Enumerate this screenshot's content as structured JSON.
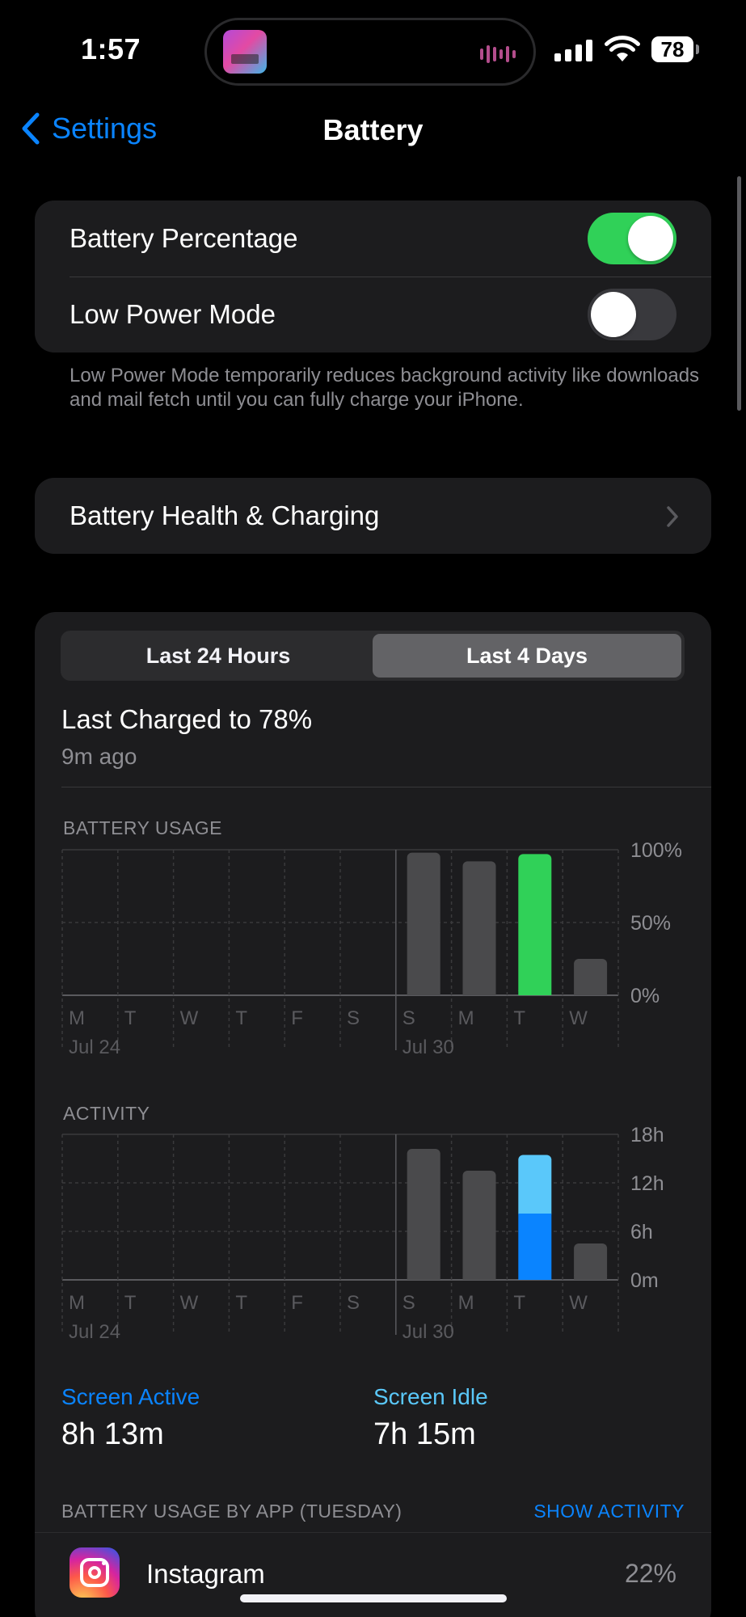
{
  "status_bar": {
    "time": "1:57",
    "battery_level": "78",
    "signal_bars": 4,
    "icons": [
      "now-playing-art",
      "audio-waveform-icon",
      "cellular-signal-icon",
      "wifi-icon",
      "battery-icon"
    ]
  },
  "nav": {
    "back_label": "Settings",
    "title": "Battery",
    "back_icon": "chevron-left-icon"
  },
  "settings": {
    "battery_percentage": {
      "label": "Battery Percentage",
      "on": true
    },
    "low_power_mode": {
      "label": "Low Power Mode",
      "on": false
    },
    "low_power_footnote": "Low Power Mode temporarily reduces background activity like downloads and mail fetch until you can fully charge your iPhone.",
    "battery_health_label": "Battery Health & Charging"
  },
  "usage": {
    "segments": [
      "Last 24 Hours",
      "Last 4 Days"
    ],
    "selected_segment": "Last 4 Days",
    "last_charged": "Last Charged to 78%",
    "last_charged_ago": "9m ago",
    "screen_active_label": "Screen Active",
    "screen_active_value": "8h 13m",
    "screen_idle_label": "Screen Idle",
    "screen_idle_value": "7h 15m",
    "by_app_heading": "BATTERY USAGE BY APP (TUESDAY)",
    "show_activity": "SHOW ACTIVITY",
    "apps": [
      {
        "name": "Instagram",
        "percent": "22%",
        "icon": "instagram-icon"
      }
    ]
  },
  "colors": {
    "accent": "#0a84ff",
    "toggle_on": "#30d158",
    "selected_bar": "#30d158",
    "idle": "#5ac8fa",
    "active": "#0a84ff",
    "bar": "#4a4a4c"
  },
  "chart_data": [
    {
      "type": "bar",
      "title": "BATTERY USAGE",
      "categories": [
        "M",
        "T",
        "W",
        "T",
        "F",
        "S",
        "S",
        "M",
        "T",
        "W"
      ],
      "date_labels": [
        "Jul 24",
        "Jul 30"
      ],
      "yticks": [
        "100%",
        "50%",
        "0%"
      ],
      "ylim": [
        0,
        100
      ],
      "values": [
        0,
        0,
        0,
        0,
        0,
        0,
        98,
        92,
        97,
        25
      ],
      "highlighted_index": 8
    },
    {
      "type": "bar",
      "title": "ACTIVITY",
      "categories": [
        "M",
        "T",
        "W",
        "T",
        "F",
        "S",
        "S",
        "M",
        "T",
        "W"
      ],
      "date_labels": [
        "Jul 24",
        "Jul 30"
      ],
      "yticks": [
        "18h",
        "12h",
        "6h",
        "0m"
      ],
      "ylim": [
        0,
        18
      ],
      "series": [
        {
          "name": "Screen Active",
          "values": [
            0,
            0,
            0,
            0,
            0,
            0,
            0,
            0,
            8.2,
            0
          ]
        },
        {
          "name": "Screen Idle",
          "values": [
            0,
            0,
            0,
            0,
            0,
            0,
            0,
            0,
            7.25,
            0
          ]
        }
      ],
      "totals": [
        0,
        0,
        0,
        0,
        0,
        0,
        16.2,
        13.5,
        15.45,
        4.5
      ],
      "highlighted_index": 8
    }
  ]
}
